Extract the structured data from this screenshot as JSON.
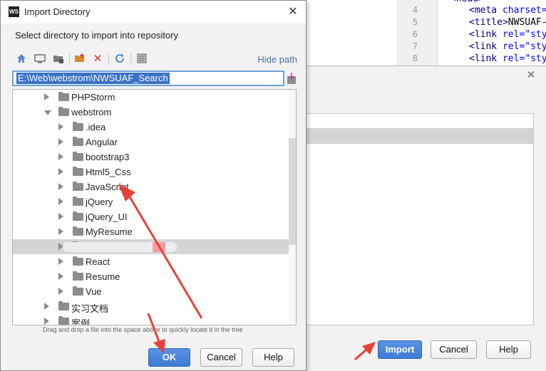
{
  "editor": {
    "lines": [
      {
        "num": "",
        "partial": true,
        "text": "<head>"
      },
      {
        "num": "4",
        "tag": "<meta ",
        "attr": "charset=",
        "rest": ""
      },
      {
        "num": "5",
        "tag": "<title>",
        "attr": "",
        "rest": "NWSUAF-"
      },
      {
        "num": "6",
        "tag": "<link ",
        "attr": "rel=\"sty",
        "rest": ""
      },
      {
        "num": "7",
        "tag": "<link ",
        "attr": "rel=\"sty",
        "rest": ""
      },
      {
        "num": "8",
        "tag": "<link ",
        "attr": "rel=\"sty",
        "rest": ""
      }
    ]
  },
  "bg_dialog": {
    "import_label": "Import",
    "cancel_label": "Cancel",
    "help_label": "Help"
  },
  "dialog": {
    "logo": "WS",
    "title": "Import Directory",
    "instruction": "Select directory to import into repository",
    "hide_path": "Hide path",
    "path_value": "E:\\Web\\webstrom\\NWSUAF_Search",
    "toolbar_icons": [
      "home-icon",
      "desktop-icon",
      "project-icon",
      "new-folder-icon",
      "delete-icon",
      "refresh-icon",
      "show-hidden-icon"
    ],
    "tree": [
      {
        "label": "PHPStorm",
        "level": 0,
        "expanded": false
      },
      {
        "label": "webstrom",
        "level": 0,
        "expanded": true
      },
      {
        "label": ".idea",
        "level": 1,
        "expanded": false
      },
      {
        "label": "Angular",
        "level": 1,
        "expanded": false
      },
      {
        "label": "bootstrap3",
        "level": 1,
        "expanded": false
      },
      {
        "label": "Html5_Css",
        "level": 1,
        "expanded": false
      },
      {
        "label": "JavaScript",
        "level": 1,
        "expanded": false
      },
      {
        "label": "jQuery",
        "level": 1,
        "expanded": false
      },
      {
        "label": "jQuery_UI",
        "level": 1,
        "expanded": false
      },
      {
        "label": "MyResume",
        "level": 1,
        "expanded": false
      },
      {
        "label": "",
        "level": 1,
        "expanded": false,
        "selected": true,
        "obscured": true
      },
      {
        "label": "React",
        "level": 1,
        "expanded": false
      },
      {
        "label": "Resume",
        "level": 1,
        "expanded": false
      },
      {
        "label": "Vue",
        "level": 1,
        "expanded": false
      },
      {
        "label": "实习文档",
        "level": 0,
        "expanded": false
      },
      {
        "label": "案例",
        "level": 0,
        "expanded": false
      }
    ],
    "hint": "Drag and drop a file into the space above to quickly locate it in the tree",
    "ok_label": "OK",
    "cancel_label": "Cancel",
    "help_label": "Help"
  },
  "colors": {
    "accent": "#3f7bd4",
    "selection": "#3a72c6",
    "annotation": "#e8413c"
  }
}
